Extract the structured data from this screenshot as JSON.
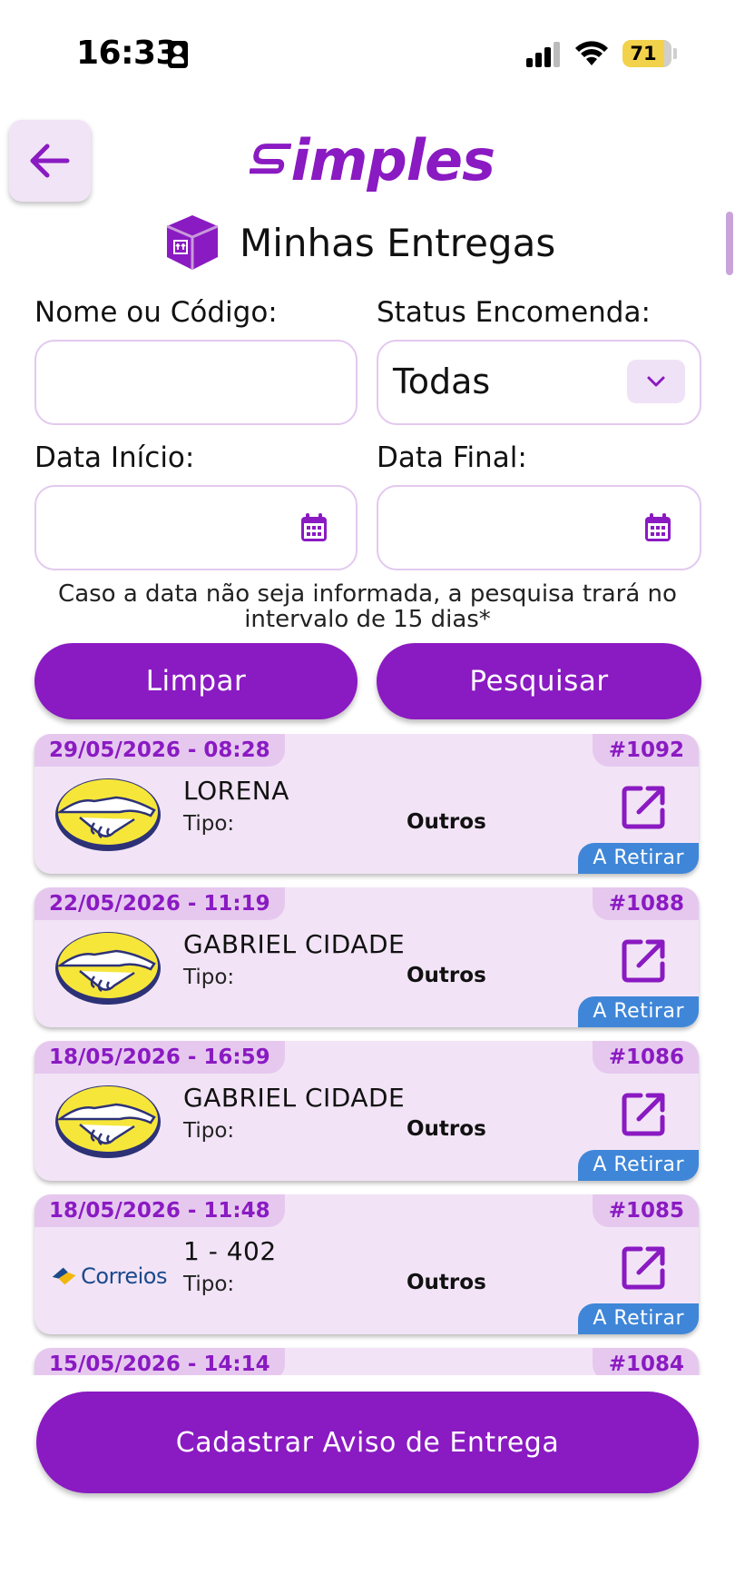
{
  "status_bar": {
    "time": "16:33",
    "battery": "71"
  },
  "header": {
    "logo_text": "imples",
    "title": "Minhas Entregas"
  },
  "filters": {
    "name_label": "Nome ou Código:",
    "name_value": "",
    "status_label": "Status Encomenda:",
    "status_value": "Todas",
    "start_label": "Data Início:",
    "start_value": "",
    "end_label": "Data Final:",
    "end_value": "",
    "hint": "Caso a data não seja informada, a pesquisa trará no intervalo de 15 dias*",
    "clear_label": "Limpar",
    "search_label": "Pesquisar"
  },
  "deliveries": [
    {
      "date": "29/05/2026 - 08:28",
      "number": "#1092",
      "name": "LORENA",
      "tipo_label": "Tipo:",
      "tipo": "Outros",
      "status": "A Retirar",
      "carrier": "mercado-livre"
    },
    {
      "date": "22/05/2026 - 11:19",
      "number": "#1088",
      "name": "GABRIEL CIDADE",
      "tipo_label": "Tipo:",
      "tipo": "Outros",
      "status": "A Retirar",
      "carrier": "mercado-livre"
    },
    {
      "date": "18/05/2026 - 16:59",
      "number": "#1086",
      "name": "GABRIEL CIDADE",
      "tipo_label": "Tipo:",
      "tipo": "Outros",
      "status": "A Retirar",
      "carrier": "mercado-livre"
    },
    {
      "date": "18/05/2026 - 11:48",
      "number": "#1085",
      "name": "1 - 402",
      "tipo_label": "Tipo:",
      "tipo": "Outros",
      "status": "A Retirar",
      "carrier": "correios",
      "carrier_text": "Correios"
    },
    {
      "date": "15/05/2026 - 14:14",
      "number": "#1084"
    }
  ],
  "footer": {
    "register_label": "Cadastrar Aviso de Entrega"
  },
  "colors": {
    "accent": "#8a1ac2",
    "card_bg": "#f2e4f6",
    "status_blue": "#3f86d8"
  }
}
